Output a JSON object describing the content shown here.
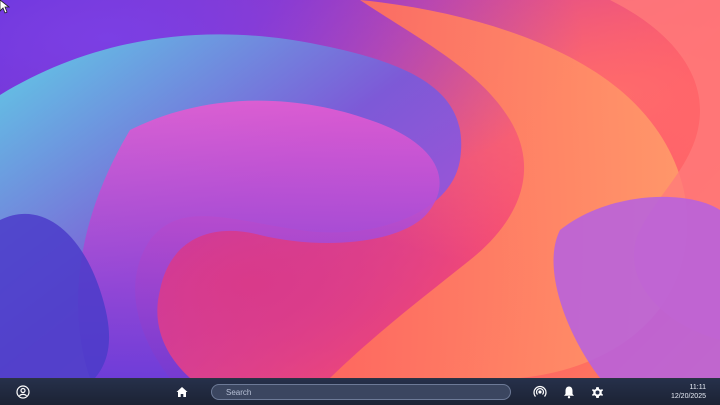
{
  "wallpaper": {
    "description_colors": [
      "#7b3fe4",
      "#5fd7e6",
      "#ff4f6a",
      "#ff8a58",
      "#d93a8a"
    ]
  },
  "taskbar": {
    "search_placeholder": "Search",
    "clock": {
      "time": "11:11",
      "date": "12/20/2025"
    },
    "icons": {
      "account": "account-circle-icon",
      "home": "home-icon",
      "broadcast": "broadcast-icon",
      "notifications": "bell-icon",
      "settings": "gear-icon"
    },
    "accent": "#3b4660"
  }
}
